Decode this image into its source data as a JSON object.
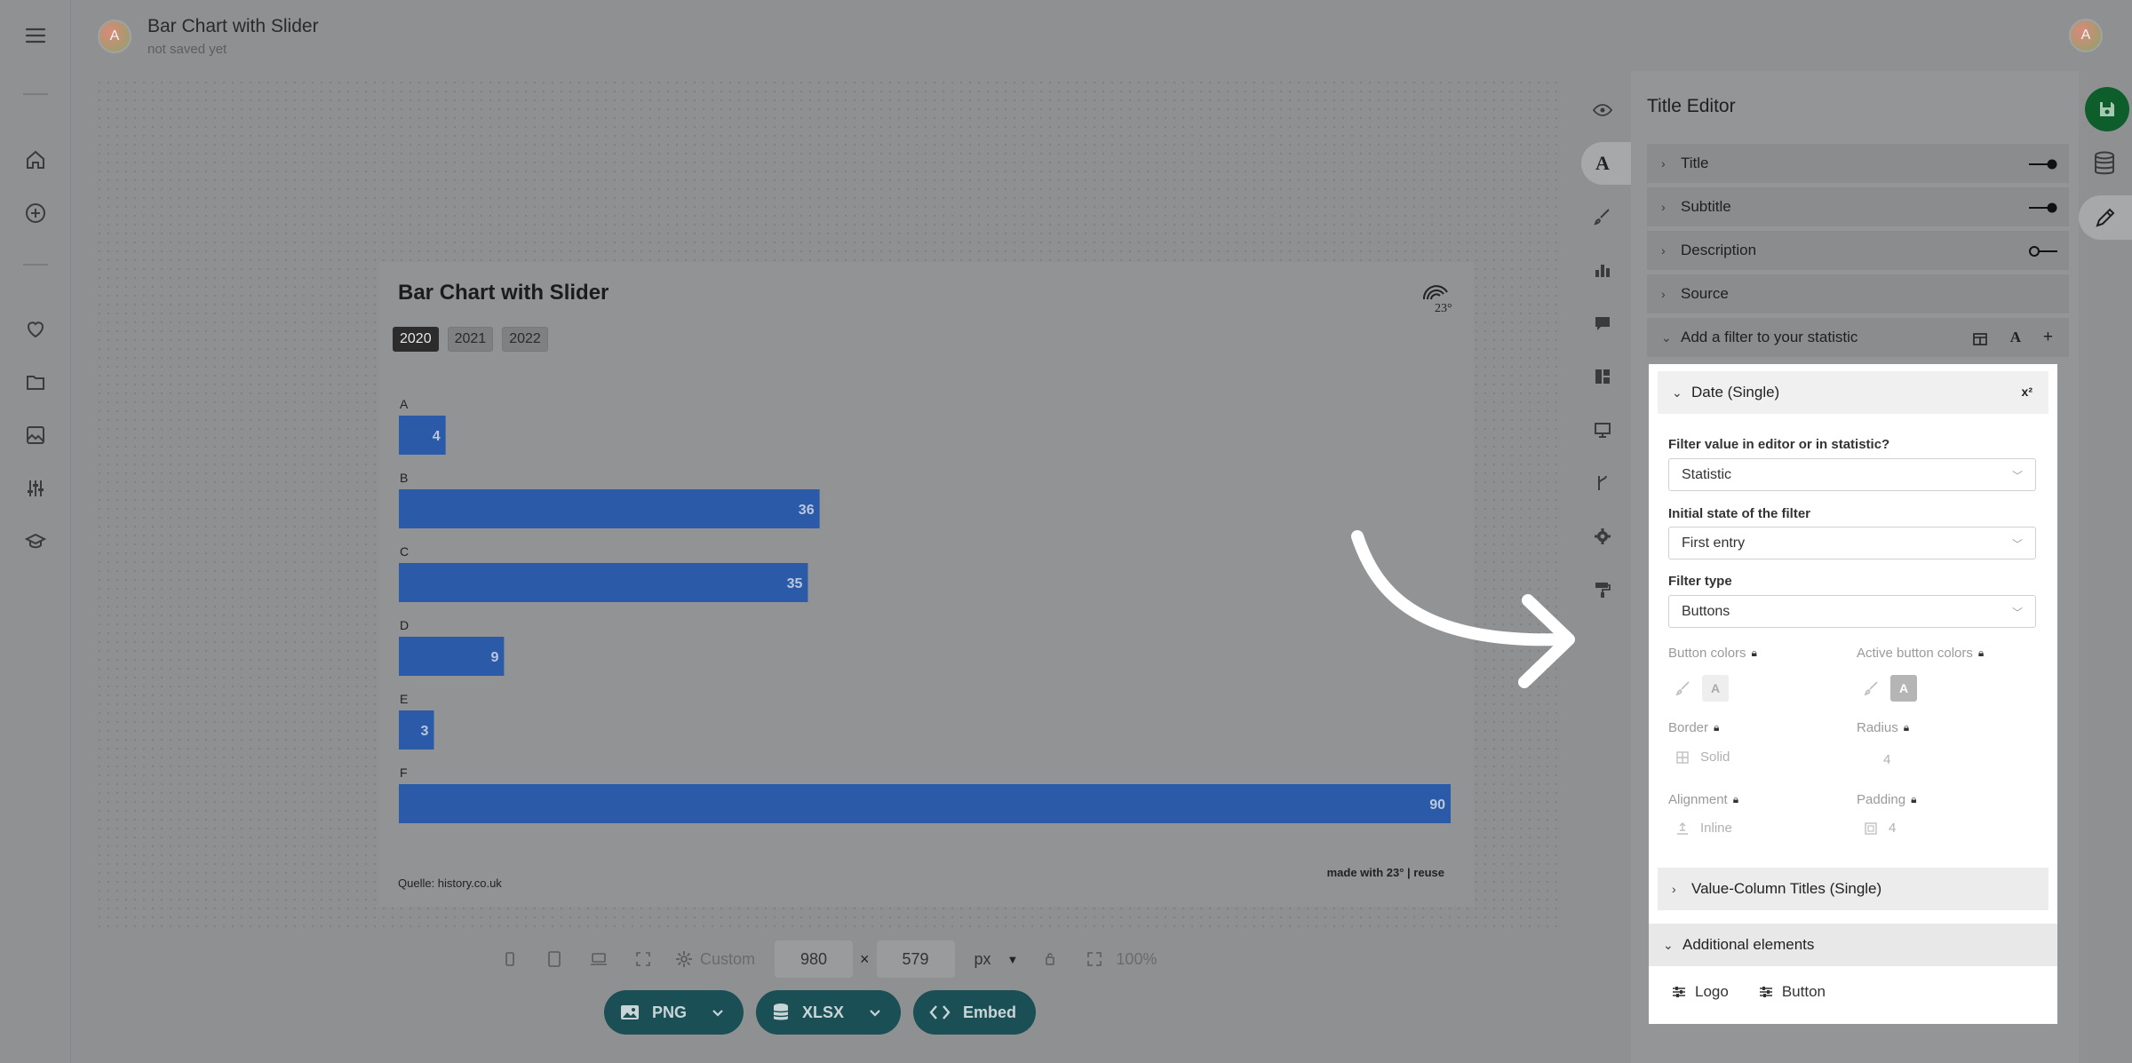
{
  "document": {
    "avatar_initial": "A",
    "title": "Bar Chart with Slider",
    "status": "not saved yet"
  },
  "user": {
    "avatar_initial": "A"
  },
  "left_rail": [
    "menu-icon",
    "home-icon",
    "add-icon",
    "heart-icon",
    "folder-icon",
    "image-icon",
    "sliders-icon",
    "graduation-icon"
  ],
  "chart": {
    "title": "Bar Chart with Slider",
    "years": [
      "2020",
      "2021",
      "2022"
    ],
    "active_year": "2020",
    "source": "Quelle: history.co.uk",
    "made_with": "made with 23° | reuse"
  },
  "chart_data": {
    "type": "bar",
    "orientation": "horizontal",
    "categories": [
      "A",
      "B",
      "C",
      "D",
      "E",
      "F"
    ],
    "values": [
      4,
      36,
      35,
      9,
      3,
      90
    ],
    "title": "Bar Chart with Slider",
    "xlim": [
      0,
      90
    ],
    "color": "#2a5aa8",
    "grid": false
  },
  "bottom": {
    "preset": "Custom",
    "width": "980",
    "times": "×",
    "height": "579",
    "unit": "px",
    "zoom": "100%"
  },
  "export": {
    "png": "PNG",
    "xlsx": "XLSX",
    "embed": "Embed"
  },
  "editor": {
    "title": "Title Editor",
    "sections": {
      "title": "Title",
      "subtitle": "Subtitle",
      "description": "Description",
      "source": "Source",
      "filter": "Add a filter to your statistic"
    },
    "filter": {
      "header": "Date (Single)",
      "close": "x²",
      "q1_label": "Filter value in editor or in statistic?",
      "q1_value": "Statistic",
      "q2_label": "Initial state of the filter",
      "q2_value": "First entry",
      "q3_label": "Filter type",
      "q3_value": "Buttons",
      "button_colors": "Button colors",
      "active_button_colors": "Active button colors",
      "swatch_letter": "A",
      "border": "Border",
      "border_value": "Solid",
      "radius": "Radius",
      "radius_value": "4",
      "alignment": "Alignment",
      "alignment_value": "Inline",
      "padding": "Padding",
      "padding_value": "4",
      "value_column_titles": "Value-Column Titles (Single)",
      "additional_elements": "Additional elements",
      "logo": "Logo",
      "button": "Button"
    }
  },
  "colors": {
    "bar": "#2a5aa8",
    "save": "#0d5e2a",
    "export": "#1a4f55"
  }
}
